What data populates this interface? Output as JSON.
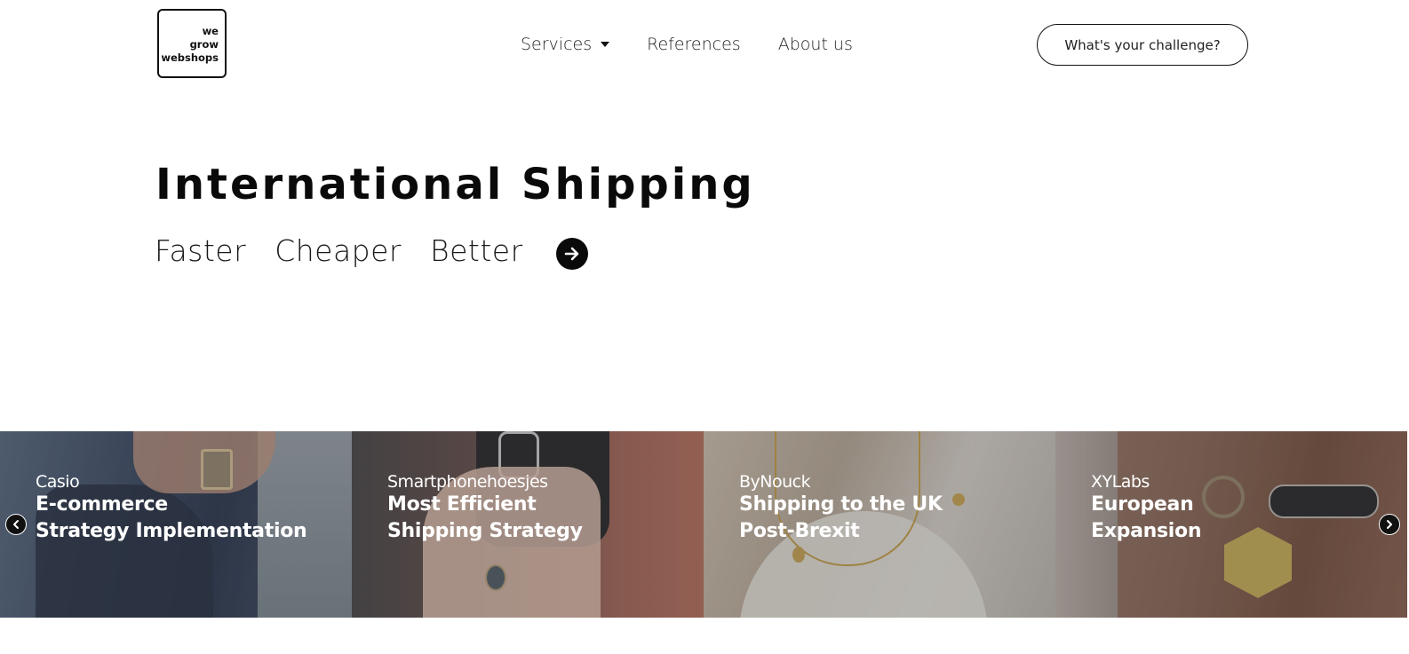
{
  "header": {
    "logo_lines": [
      "we",
      "grow",
      "webshops"
    ],
    "nav": [
      {
        "label": "Services",
        "has_dropdown": true
      },
      {
        "label": "References",
        "has_dropdown": false
      },
      {
        "label": "About us",
        "has_dropdown": false
      }
    ],
    "cta_label": "What's your challenge?"
  },
  "hero": {
    "title": "International Shipping",
    "words": [
      "Faster",
      "Cheaper",
      "Better"
    ]
  },
  "carousel": {
    "cards": [
      {
        "client": "Casio",
        "line1": "E-commerce",
        "line2": "Strategy Implementation",
        "tint": "#3f4a5e"
      },
      {
        "client": "Smartphonehoesjes",
        "line1": "Most Efficient",
        "line2": "Shipping Strategy",
        "tint": "#7a5d58"
      },
      {
        "client": "ByNouck",
        "line1": "Shipping to the UK",
        "line2": "Post-Brexit",
        "tint": "#a8a39c"
      },
      {
        "client": "XYLabs",
        "line1": "European",
        "line2": "Expansion",
        "tint": "#8a6a5c"
      }
    ]
  },
  "colors": {
    "text": "#111111",
    "background": "#ffffff",
    "overlay_text": "#ffffff"
  },
  "icons": {
    "dropdown": "caret-down-icon",
    "hero_arrow": "arrow-right-circle-icon",
    "carousel_prev": "chevron-left-icon",
    "carousel_next": "chevron-right-icon"
  }
}
